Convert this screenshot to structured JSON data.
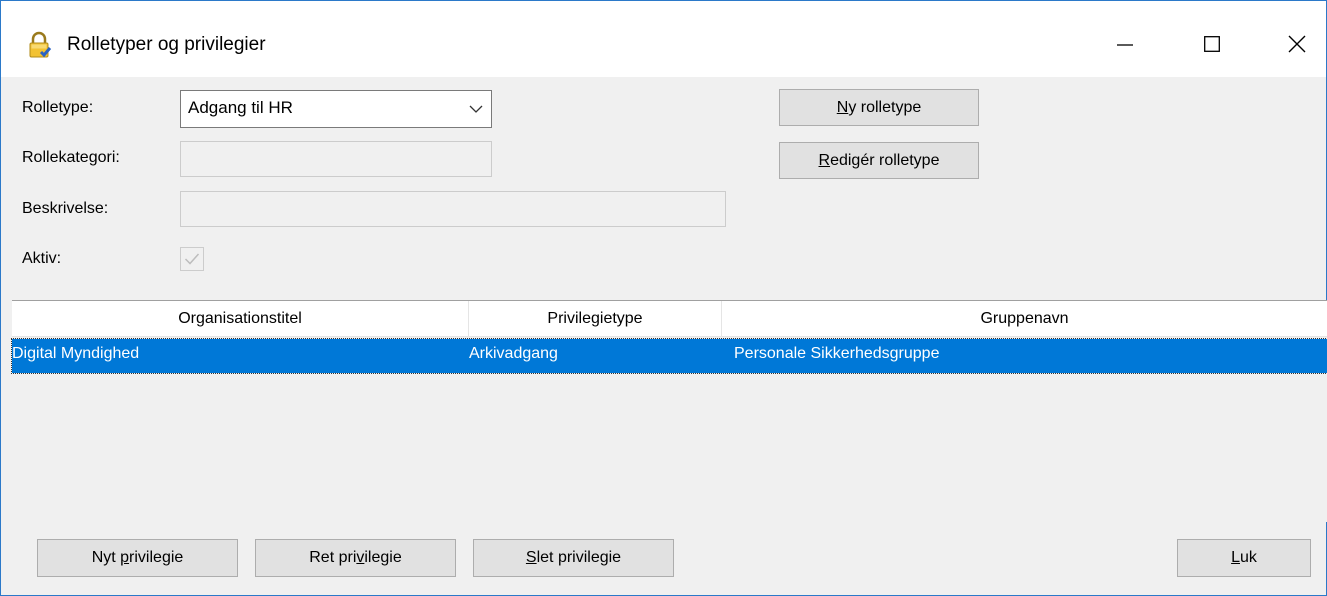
{
  "window": {
    "title": "Rolletyper og privilegier"
  },
  "form": {
    "rolletype_label": "Rolletype:",
    "rolletype_value": "Adgang til HR",
    "rollekategori_label": "Rollekategori:",
    "rollekategori_value": "",
    "beskrivelse_label": "Beskrivelse:",
    "beskrivelse_value": "",
    "aktiv_label": "Aktiv:",
    "aktiv_checked": true
  },
  "buttons": {
    "ny_rolletype": {
      "mnemonic": "N",
      "rest": "y rolletype"
    },
    "rediger_rolletype": {
      "mnemonic": "R",
      "rest": "edigér rolletype"
    },
    "nyt_privilegie": {
      "before": "Nyt ",
      "mnemonic": "p",
      "rest": "rivilegie"
    },
    "ret_privilegie": {
      "before": "Ret pri",
      "mnemonic": "v",
      "rest": "ilegie"
    },
    "slet_privilegie": {
      "mnemonic": "S",
      "rest": "let privilegie"
    },
    "luk": {
      "mnemonic": "L",
      "rest": "uk"
    }
  },
  "table": {
    "columns": [
      "Organisationstitel",
      "Privilegietype",
      "Gruppenavn"
    ],
    "rows": [
      {
        "organisationstitel": "Digital Myndighed",
        "privilegietype": "Arkivadgang",
        "gruppenavn": "Personale Sikkerhedsgruppe"
      }
    ]
  },
  "icons": {
    "title": "lock-icon",
    "combo": "chevron-down-icon",
    "minimize": "minimize-icon",
    "maximize": "maximize-icon",
    "close": "close-icon",
    "check": "check-icon"
  },
  "colors": {
    "selection": "#0078d7",
    "window_border": "#2b79c9",
    "background": "#f0f0f0"
  }
}
